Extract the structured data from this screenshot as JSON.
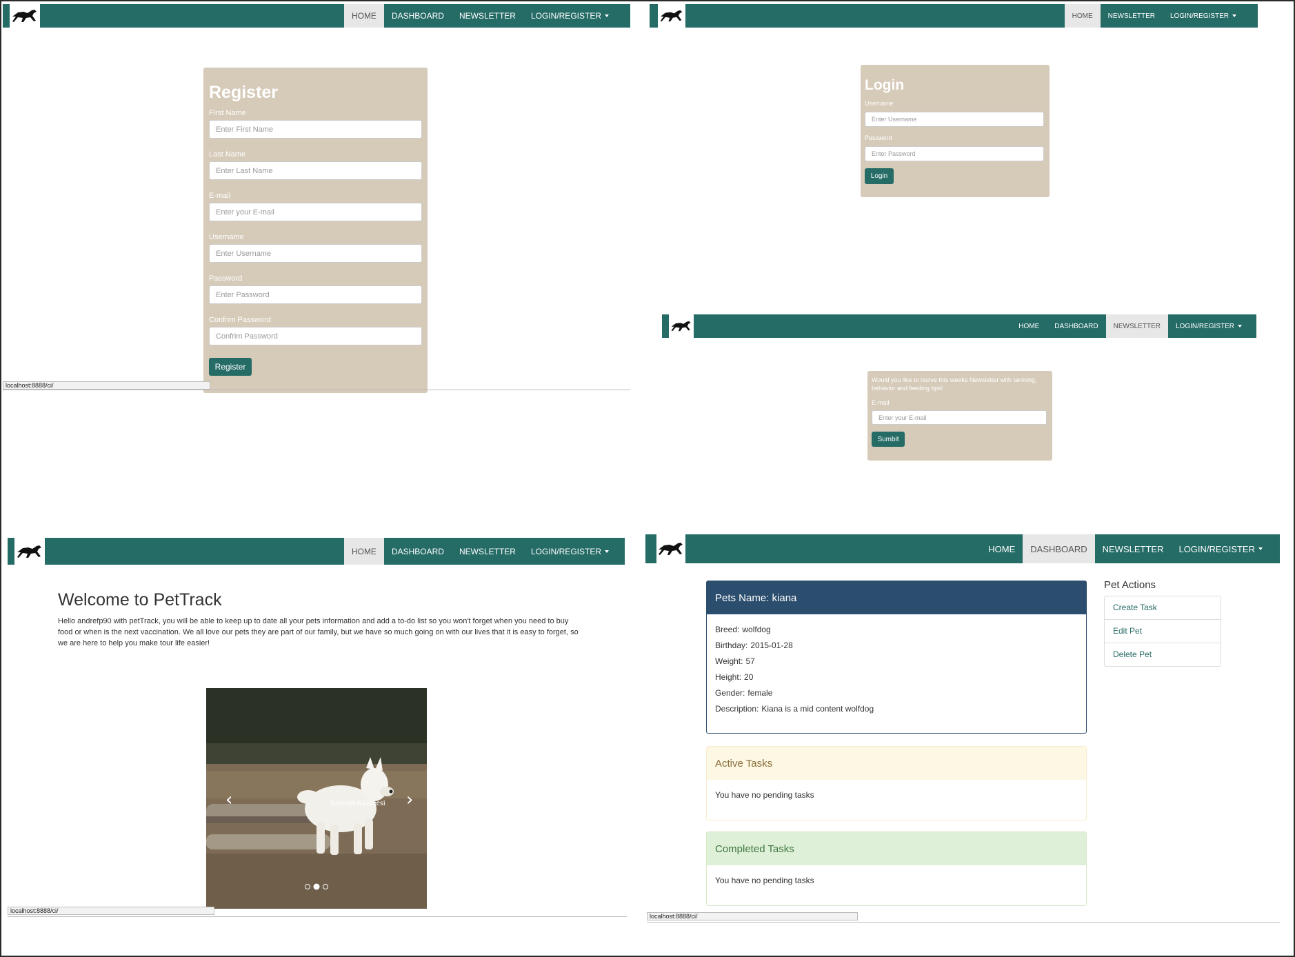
{
  "nav": {
    "home": "HOME",
    "dashboard": "DASHBOARD",
    "newsletter": "NEWSLETTER",
    "login_register": "LOGIN/REGISTER"
  },
  "status_url": "localhost:8888/ci/",
  "register": {
    "title": "Register",
    "fields": [
      {
        "label": "First Name",
        "placeholder": "Enter First Name"
      },
      {
        "label": "Last Name",
        "placeholder": "Enter Last Name"
      },
      {
        "label": "E-mail",
        "placeholder": "Enter your E-mail"
      },
      {
        "label": "Username",
        "placeholder": "Enter Username"
      },
      {
        "label": "Password",
        "placeholder": "Enter Password"
      },
      {
        "label": "Confrim Password",
        "placeholder": "Confrim Password"
      }
    ],
    "button": "Register"
  },
  "login": {
    "title": "Login",
    "username_label": "Username",
    "username_placeholder": "Enter Username",
    "password_label": "Password",
    "password_placeholder": "Enter Password",
    "button": "Login"
  },
  "newsletter": {
    "text": "Would you like to recive this weeks Newsletter with tanining, behavior and feeding tips!",
    "email_label": "E-mail",
    "email_placeholder": "Enter your E-mail",
    "button": "Sumbit"
  },
  "home": {
    "heading": "Welcome to PetTrack",
    "intro": "Hello andrefp90 with petTrack, you will be able to keep up to date all your pets information and add a to-do list so you won't forget when you need to buy food or when is the next vaccination. We all love our pets they are part of our family, but we have so much going on with our lives that it is easy to forget, so we are here to help you make tour life easier!",
    "carousel_caption": "Kiana&Khaleesi"
  },
  "dashboard": {
    "pet_header": "Pets Name: kiana",
    "details": [
      {
        "key": "Breed:",
        "value": "wolfdog"
      },
      {
        "key": "Birthday:",
        "value": "2015-01-28"
      },
      {
        "key": "Weight:",
        "value": "57"
      },
      {
        "key": "Height:",
        "value": "20"
      },
      {
        "key": "Gender:",
        "value": "female"
      },
      {
        "key": "Description:",
        "value": "Kiana is a mid content wolfdog"
      }
    ],
    "active_title": "Active Tasks",
    "active_body": "You have no pending tasks",
    "completed_title": "Completed Tasks",
    "completed_body": "You have no pending tasks",
    "actions_title": "Pet Actions",
    "actions": [
      "Create Task",
      "Edit Pet",
      "Delete Pet"
    ]
  },
  "colors": {
    "nav": "#256b66",
    "card": "#d6cab9",
    "pet_header": "#2c4e6e",
    "active_bg": "#fcf8e3",
    "completed_bg": "#dff0d8"
  }
}
